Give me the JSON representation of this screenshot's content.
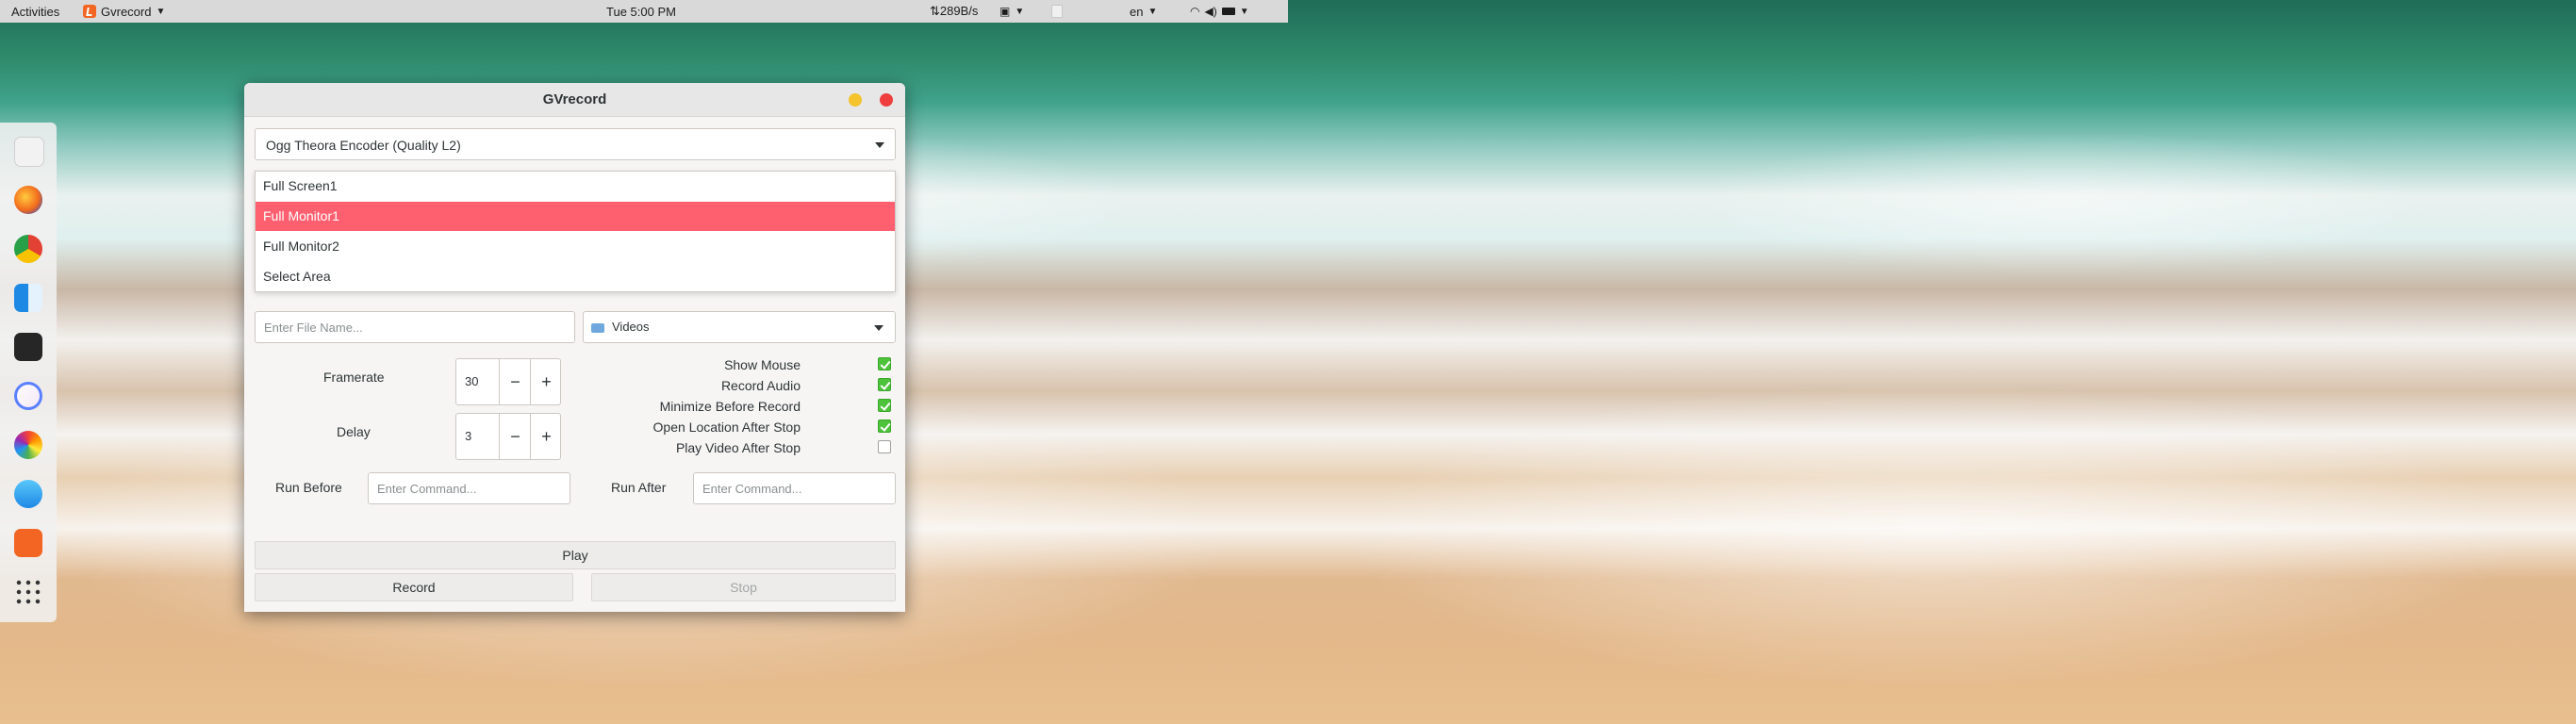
{
  "topbar": {
    "activities": "Activities",
    "app_name": "Gvrecord",
    "clock": "Tue  5:00 PM",
    "net_speed": "⇅289B/s",
    "lang": "en"
  },
  "dock": {
    "items": [
      "calendar-icon",
      "firefox-icon",
      "chrome-icon",
      "finder-icon",
      "terminal-icon",
      "music-icon",
      "photos-icon",
      "app-store-icon",
      "gvrecord-icon",
      "app-grid-icon"
    ]
  },
  "window": {
    "title": "GVrecord",
    "encoder": "Ogg Theora Encoder (Quality L2)",
    "area_options": [
      "Full Screen1",
      "Full Monitor1",
      "Full Monitor2",
      "Select Area"
    ],
    "selected_area": "Full Monitor1",
    "filename_placeholder": "Enter File Name...",
    "folder": "Videos",
    "framerate_label": "Framerate",
    "framerate_value": "30",
    "delay_label": "Delay",
    "delay_value": "3",
    "minus": "−",
    "plus": "+",
    "options": [
      {
        "label": "Show Mouse",
        "checked": true
      },
      {
        "label": "Record Audio",
        "checked": true
      },
      {
        "label": "Minimize Before Record",
        "checked": true
      },
      {
        "label": "Open Location After Stop",
        "checked": true
      },
      {
        "label": "Play Video After Stop",
        "checked": false
      }
    ],
    "run_before_label": "Run Before",
    "run_before_placeholder": "Enter Command...",
    "run_after_label": "Run After",
    "run_after_placeholder": "Enter Command...",
    "play_label": "Play",
    "record_label": "Record",
    "stop_label": "Stop"
  }
}
